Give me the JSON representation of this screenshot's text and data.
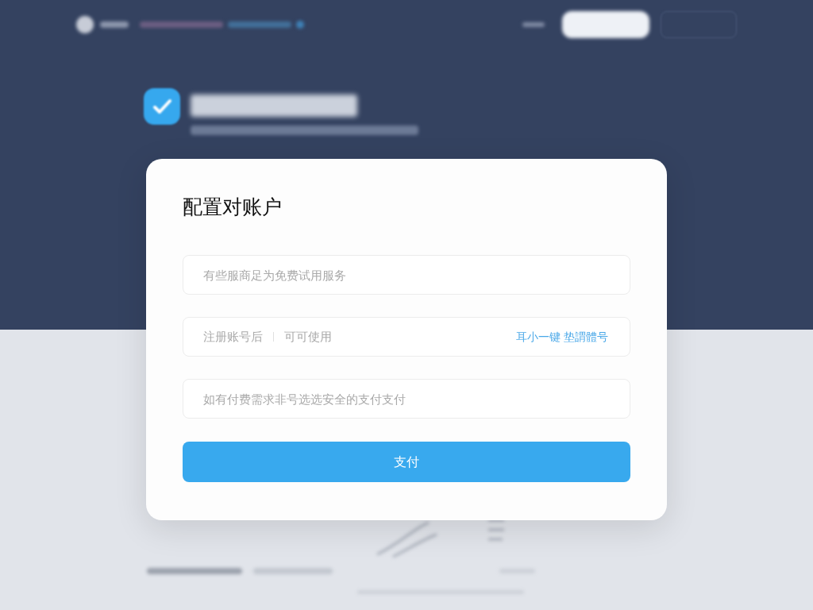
{
  "dialog": {
    "title": "配置对账户",
    "fields": [
      {
        "kind": "input",
        "placeholder": "有些服商足为免费试用服务"
      },
      {
        "kind": "prefixed",
        "prefix": "注册账号后",
        "placeholder": "可可使用",
        "link": "耳小一键 垫謂體号"
      },
      {
        "kind": "input",
        "placeholder": "如有付费需求非号选选安全的支付支付"
      }
    ],
    "submit_button": "支付"
  }
}
